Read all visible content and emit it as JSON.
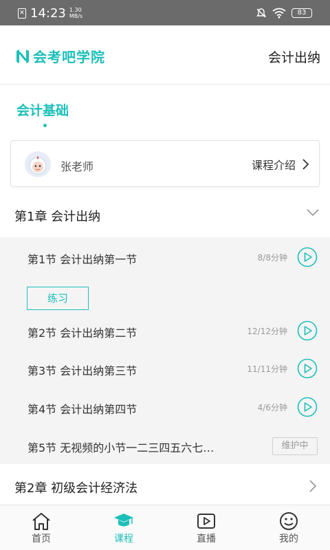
{
  "status_bar": {
    "time": "14:23",
    "speed_value": "1.30",
    "speed_unit": "MB/s",
    "battery": "83"
  },
  "header": {
    "app_name": "会考吧学院",
    "course_name": "会计出纳"
  },
  "course_tab": {
    "label": "会计基础"
  },
  "teacher_card": {
    "teacher_name": "张老师",
    "intro_label": "课程介绍"
  },
  "chapters": [
    {
      "title": "第1章  会计出纳",
      "expanded": true,
      "lessons": [
        {
          "title": "第1节  会计出纳第一节",
          "duration": "8/8分钟",
          "practice_label": "练习"
        },
        {
          "title": "第2节  会计出纳第二节",
          "duration": "12/12分钟"
        },
        {
          "title": "第3节  会计出纳第三节",
          "duration": "11/11分钟"
        },
        {
          "title": "第4节  会计出纳第四节",
          "duration": "4/6分钟"
        },
        {
          "title": "第5节  无视频的小节一二三四五六七…",
          "status": "维护中"
        }
      ]
    },
    {
      "title": "第2章  初级会计经济法",
      "expanded": false
    }
  ],
  "bottom_nav": [
    {
      "label": "首页",
      "icon": "home-icon",
      "active": false
    },
    {
      "label": "课程",
      "icon": "graduation-cap-icon",
      "active": true
    },
    {
      "label": "直播",
      "icon": "live-play-icon",
      "active": false
    },
    {
      "label": "我的",
      "icon": "smiley-icon",
      "active": false
    }
  ],
  "colors": {
    "accent": "#1cbfb9",
    "status_bar": "#6b6b6b",
    "lesson_panel_bg": "#f4f4f4"
  }
}
